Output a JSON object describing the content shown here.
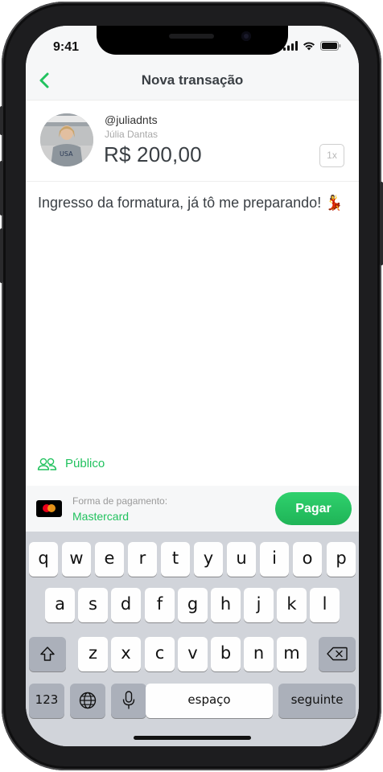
{
  "status": {
    "time": "9:41"
  },
  "nav": {
    "title": "Nova transação",
    "back_icon": "chevron-left-icon"
  },
  "recipient": {
    "handle": "@juliadnts",
    "name": "Júlia Dantas",
    "amount": "R$ 200,00",
    "installments": "1x"
  },
  "message": "Ingresso da formatura, já tô me preparando! 💃",
  "privacy": {
    "label": "Público",
    "icon": "people-icon"
  },
  "payment": {
    "label": "Forma de pagamento:",
    "method": "Mastercard",
    "button": "Pagar"
  },
  "colors": {
    "accent": "#21c25e",
    "title": "#3a3f44"
  },
  "keyboard": {
    "row1": [
      "q",
      "w",
      "e",
      "r",
      "t",
      "y",
      "u",
      "i",
      "o",
      "p"
    ],
    "row2": [
      "a",
      "s",
      "d",
      "f",
      "g",
      "h",
      "j",
      "k",
      "l"
    ],
    "row3": [
      "z",
      "x",
      "c",
      "v",
      "b",
      "n",
      "m"
    ],
    "numbers": "123",
    "space": "espaço",
    "return": "seguinte"
  }
}
